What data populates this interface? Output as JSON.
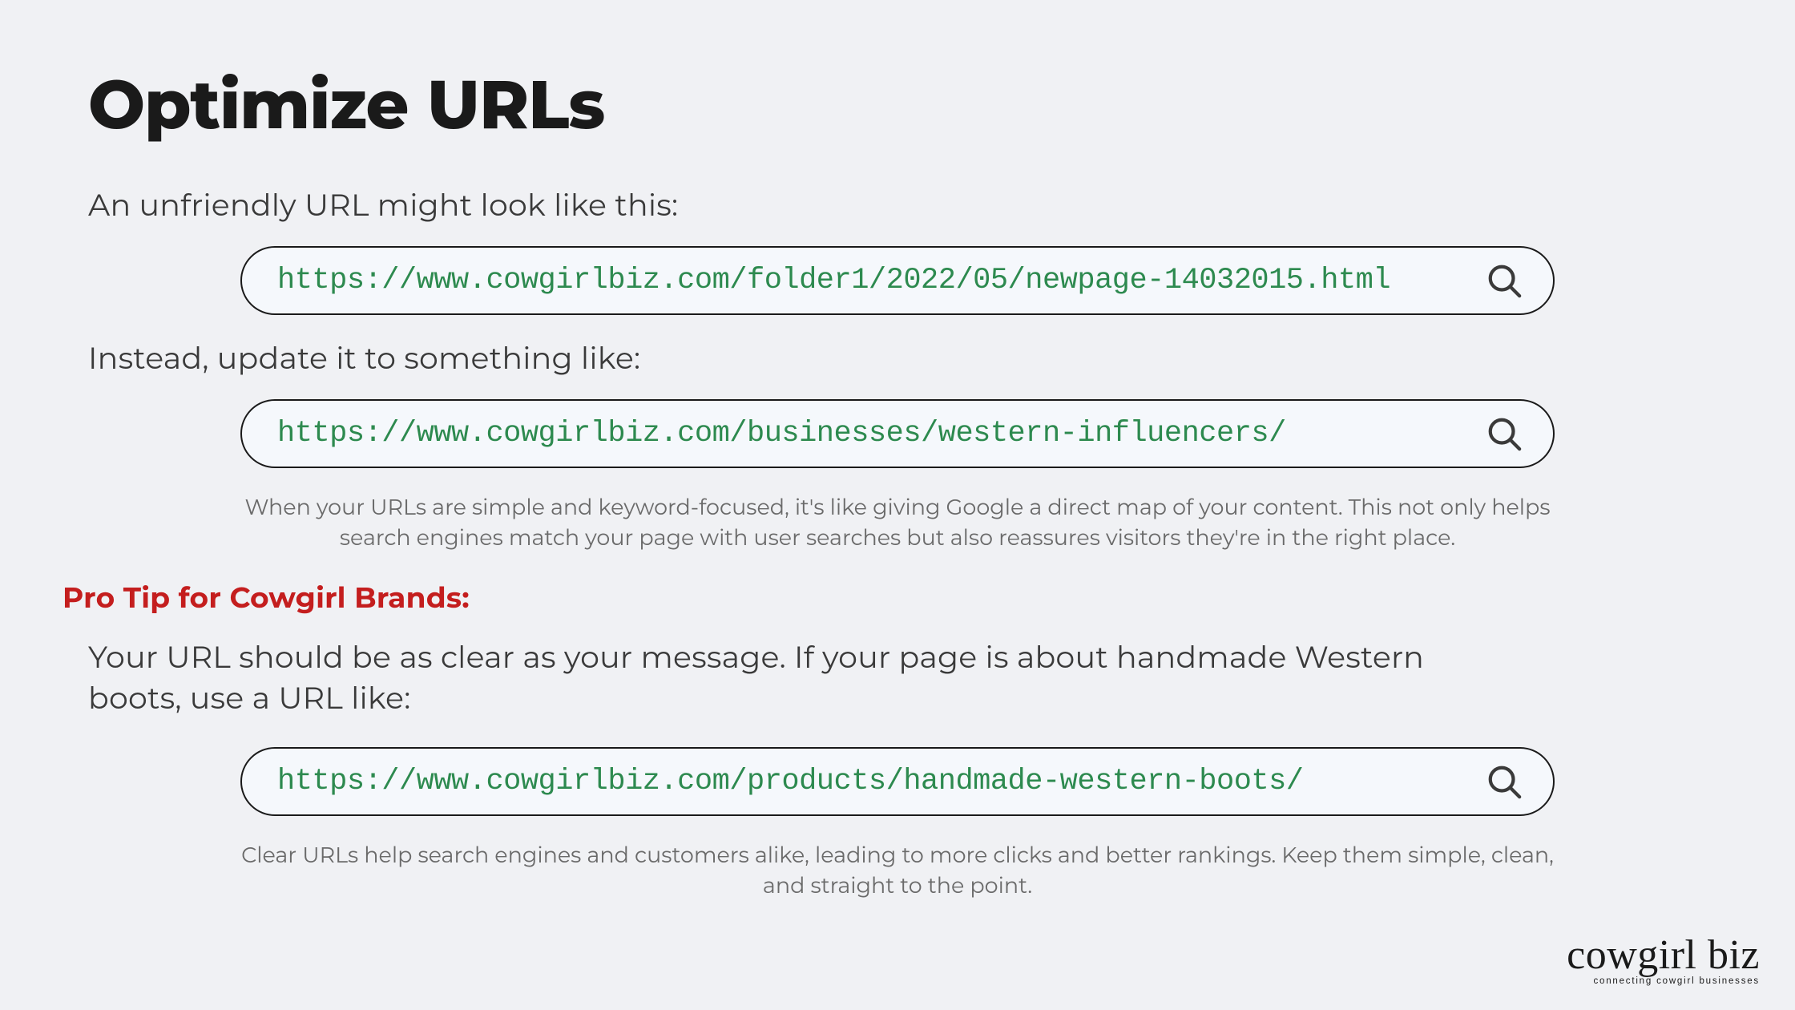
{
  "title": "Optimize URLs",
  "intro1": "An unfriendly URL might look like this:",
  "url1": "https://www.cowgirlbiz.com/folder1/2022/05/newpage-14032015.html",
  "intro2": "Instead, update it to something like:",
  "url2": "https://www.cowgirlbiz.com/businesses/western-influencers/",
  "explain1": "When your URLs are simple and keyword-focused, it's like giving Google a direct map of your content. This not only helps search engines match your page with user searches but also reassures visitors they're in the right place.",
  "pro_tip_heading": "Pro Tip for Cowgirl Brands:",
  "tip_text": "Your URL should be as clear as your message. If your page is about handmade Western boots, use a URL like:",
  "url3": "https://www.cowgirlbiz.com/products/handmade-western-boots/",
  "explain2": "Clear URLs help search engines and customers alike, leading to more clicks and better rankings. Keep them simple, clean, and straight to the point.",
  "logo_main": "cowgirl biz",
  "logo_tag": "connecting cowgirl businesses"
}
